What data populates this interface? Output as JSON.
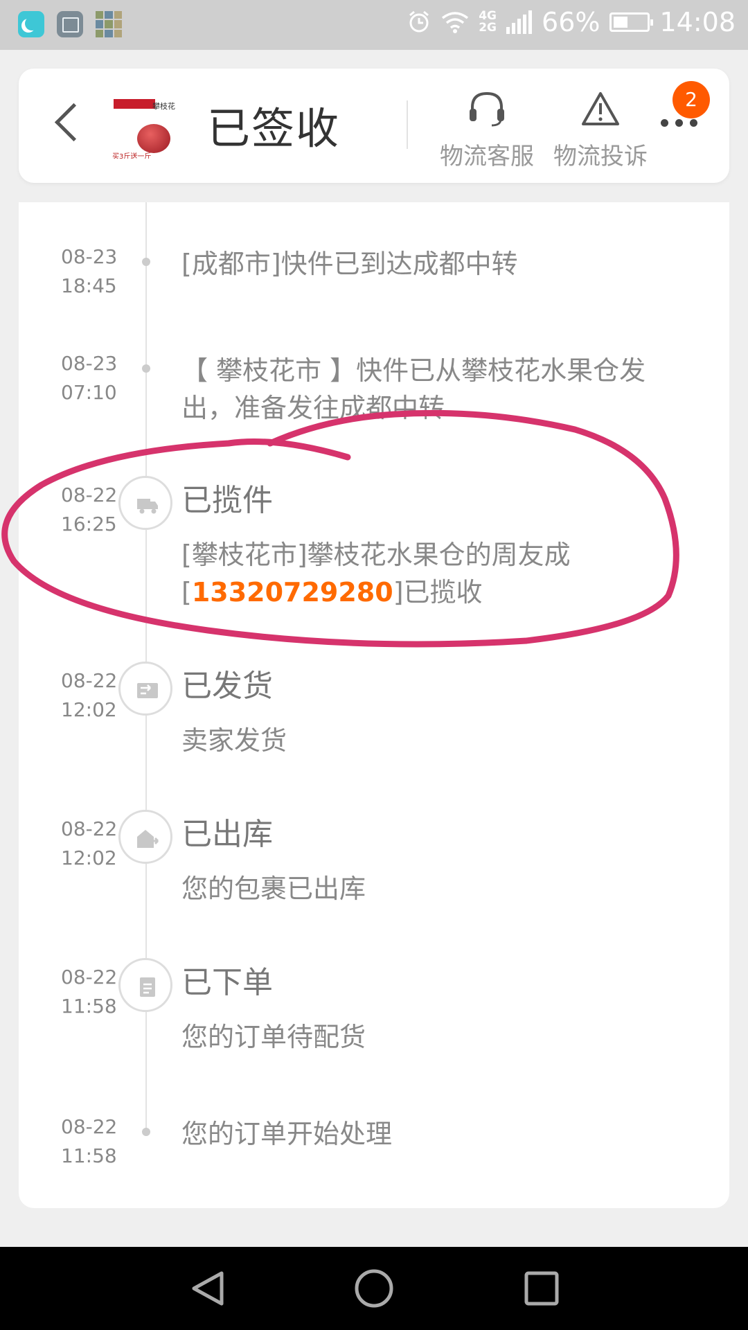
{
  "status_bar": {
    "battery": "66%",
    "time": "14:08",
    "network_top": "4G",
    "network_bottom": "2G"
  },
  "header": {
    "title": "已签收",
    "product_thumb": {
      "top_text": "攀枝花",
      "bottom_text": "买3斤送一斤"
    },
    "customer_service_label": "物流客服",
    "complaint_label": "物流投诉",
    "more_badge": "2"
  },
  "timeline": [
    {
      "date": "08-23",
      "time": "18:45",
      "text": "[成都市]快件已到达成都中转"
    },
    {
      "date": "08-23",
      "time": "07:10",
      "text_line1": "【 攀枝花市 】快件已从攀枝花水果仓发",
      "text_line2": "出，准备发往成都中转"
    },
    {
      "date": "08-22",
      "time": "16:25",
      "status": "已揽件",
      "detail_line1": "[攀枝花市]攀枝花水果仓的周友成",
      "detail_prefix": "[",
      "phone": "13320729280",
      "detail_suffix": "]已揽收",
      "icon": "truck-icon"
    },
    {
      "date": "08-22",
      "time": "12:02",
      "status": "已发货",
      "detail": "卖家发货",
      "icon": "shipping-icon"
    },
    {
      "date": "08-22",
      "time": "12:02",
      "status": "已出库",
      "detail": "您的包裹已出库",
      "icon": "warehouse-exit-icon"
    },
    {
      "date": "08-22",
      "time": "11:58",
      "status": "已下单",
      "detail": "您的订单待配货",
      "icon": "order-icon"
    },
    {
      "date": "08-22",
      "time": "11:58",
      "text": "您的订单开始处理"
    }
  ],
  "colors": {
    "accent": "#ff6a00",
    "badge": "#ff5a00",
    "annotation": "#d6336c"
  },
  "nav": {
    "icons": [
      "back-triangle-icon",
      "home-circle-icon",
      "recents-square-icon"
    ]
  }
}
